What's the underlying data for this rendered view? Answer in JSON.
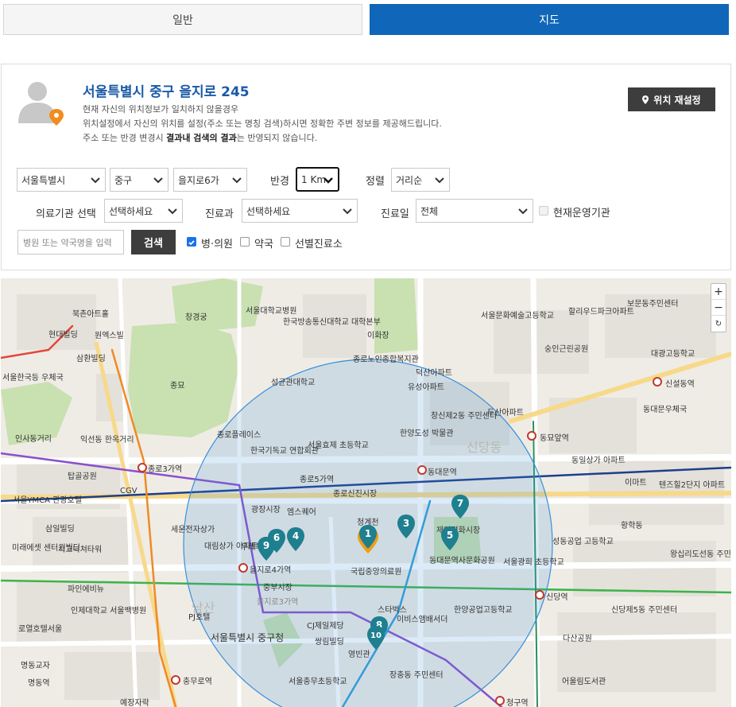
{
  "tabs": {
    "general": "일반",
    "map": "지도"
  },
  "location": {
    "title": "서울특별시 중구 을지로 245",
    "line1": "현재 자신의 위치정보가 일치하지 않을경우",
    "line2": "위치설정에서 자신의 위치를 설정(주소 또는 명칭 검색)하시면 정확한 주변 정보를 제공해드립니다.",
    "line3_pre": "주소 또는 반경 변경시 ",
    "line3_bold": "결과내 검색의 결과",
    "line3_post": "는 반영되지 않습니다.",
    "reset_button": "위치 재설정"
  },
  "filters": {
    "sido": "서울특별시",
    "sigungu": "중구",
    "dong": "을지로6가",
    "radius_label": "반경",
    "radius": "1 Km",
    "sort_label": "정렬",
    "sort": "거리순",
    "institution_label": "의료기관 선택",
    "institution": "선택하세요",
    "department_label": "진료과",
    "department": "선택하세요",
    "day_label": "진료일",
    "day": "전체",
    "operating_label": "현재운영기관",
    "search_placeholder": "병원 또는 약국명을 입력",
    "search_button": "검색",
    "type_hospital": "병·의원",
    "type_pharmacy": "약국",
    "type_screening": "선별진료소"
  },
  "map": {
    "zoom_in": "+",
    "zoom_out": "−",
    "reset": "↻",
    "markers": [
      "1",
      "3",
      "4",
      "5",
      "6",
      "7",
      "8",
      "9",
      "10"
    ],
    "labels": {
      "l1": "서울대학교병원",
      "l2": "한국방송통신대학교 대학본부",
      "l3": "이화장",
      "l4": "종로노인종합복지관",
      "l5": "서울문화예술고등학교",
      "l6": "할리우드파크아파트",
      "l7": "동묘앞역",
      "l8": "신설동역",
      "l9": "동대문역",
      "l10": "종로5가역",
      "l11": "종로3가역",
      "l12": "을지로4가역",
      "l13": "을지로3가역",
      "l14": "청계천",
      "l15": "국립중앙의료원",
      "l16": "스타벅스",
      "l17": "CJ제일제당",
      "l18": "영빈관",
      "l19": "서울특별시 중구청",
      "l20": "충무로역",
      "l21": "신당역",
      "l22": "청구역",
      "l23": "동대문역사문화공원",
      "l24": "세운전자상가",
      "l25": "종묘",
      "l26": "창경궁",
      "l27": "광장시장",
      "l28": "엠스퀘어",
      "l29": "인제대학교 서울백병원",
      "l30": "명동교자",
      "l31": "장충동 주민센터",
      "l32": "신당동",
      "l33": "황학동",
      "l34": "왕십리도선동 주민센터",
      "l35": "창신제2동 주민센터",
      "l36": "숭인근린공원",
      "l37": "보문동주민센터",
      "l38": "대광고등학교",
      "l39": "동대문우체국",
      "l40": "이마트",
      "l41": "현대빌딩",
      "l42": "삼환빌딩",
      "l43": "CGV",
      "l44": "서울YMCA 관광호텔",
      "l45": "시그니쳐타워",
      "l46": "미래에셋 센터원빌딩",
      "l47": "파인에비뉴",
      "l48": "서울충무초등학교",
      "l49": "을지로동 주민센터",
      "l50": "남산",
      "l51": "종로플레이스",
      "l52": "한국기독교 연합회관",
      "l53": "서울효제 초등학교",
      "l54": "한양도성 박물관",
      "l55": "유성아파트",
      "l56": "덕산아파트",
      "l57": "두산아파트",
      "l58": "동일상가 아파트",
      "l59": "텐즈힐2단지 아파트",
      "l60": "대림상가 아파트",
      "l61": "중부시장",
      "l62": "쌍림빌딩",
      "l63": "이비스앰배서더",
      "l64": "서울광희 초등학교",
      "l65": "성동공업 고등학교",
      "l66": "한양공업고등학교",
      "l67": "신당제5동 주민센터",
      "l68": "다산공원",
      "l69": "어울림도서관",
      "l70": "우래옥",
      "l71": "PJ호텔",
      "l72": "종로신진시장",
      "l73": "제일평화시장",
      "l74": "성균관대학교",
      "l75": "북촌아트홀",
      "l76": "원엑스빌",
      "l77": "서울한국등 우체국",
      "l78": "인사동거리",
      "l79": "익선동 한옥거리",
      "l80": "탑골공원",
      "l81": "삼일빌딩",
      "l82": "로열호텔서울",
      "l83": "명동역",
      "l84": "예장자락"
    }
  },
  "colors": {
    "brand_blue": "#1066b8",
    "title_blue": "#1a5aa6",
    "dark_button": "#3d3d3d",
    "marker_teal": "#1e7f8f",
    "marker_orange": "#f39c12",
    "radius_circle": "#3b8fd6"
  }
}
